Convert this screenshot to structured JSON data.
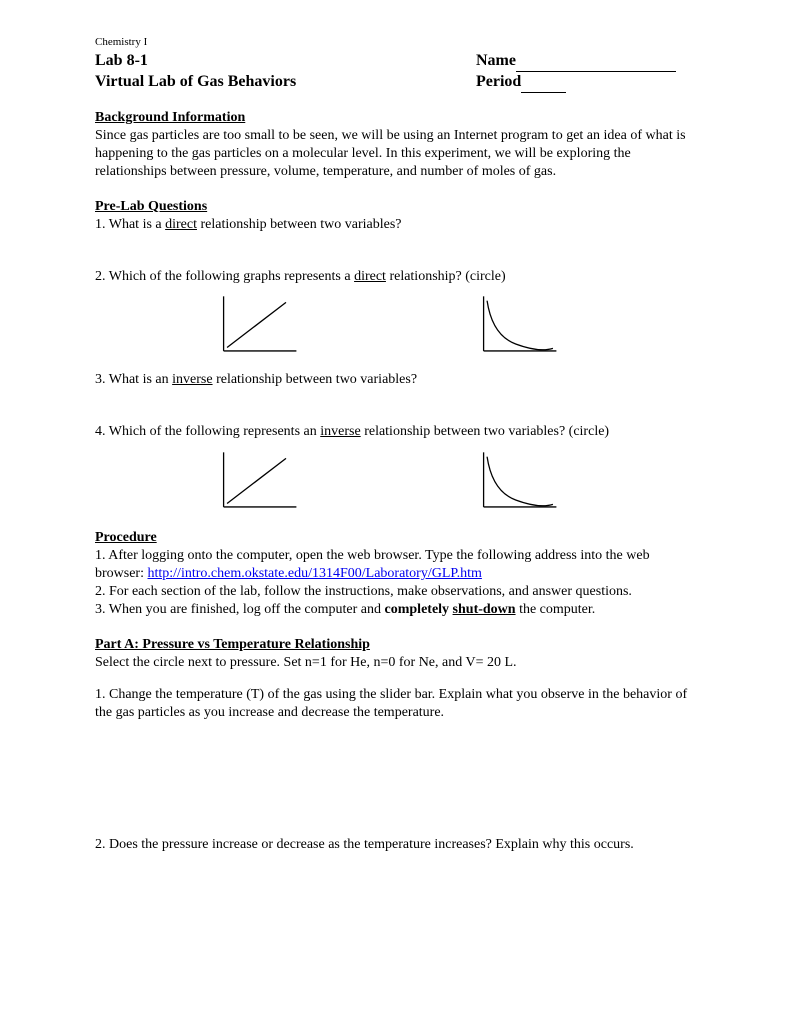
{
  "course": "Chemistry I",
  "lab_number": "Lab 8-1",
  "lab_title": "Virtual Lab of Gas Behaviors",
  "name_label": "Name",
  "period_label": "Period",
  "background": {
    "heading": "Background Information",
    "text": "Since gas particles are too small to be seen, we will be using an Internet program to get an idea of what is happening to the gas particles on a molecular level. In this experiment, we will be exploring the relationships between pressure, volume, temperature, and number of moles of gas."
  },
  "prelab": {
    "heading": "Pre-Lab Questions",
    "q1_prefix": "1. What is a ",
    "q1_u": "direct",
    "q1_suffix": " relationship between two variables?",
    "q2_prefix": "2. Which of the following graphs represents a ",
    "q2_u": "direct",
    "q2_suffix": " relationship? (circle)",
    "q3_prefix": "3. What is an ",
    "q3_u": "inverse",
    "q3_suffix": " relationship between two variables?",
    "q4_prefix": "4. Which of the following represents an ",
    "q4_u": "inverse",
    "q4_suffix": " relationship between two variables? (circle)"
  },
  "procedure": {
    "heading": "Procedure",
    "step1_prefix": "1. After logging onto the computer, open the web browser. Type the following address into the web browser: ",
    "step1_link": "http://intro.chem.okstate.edu/1314F00/Laboratory/GLP.htm",
    "step2": "2. For each section of the lab, follow the instructions, make observations, and answer questions.",
    "step3_prefix": "3. When you are finished, log off the computer and ",
    "step3_bold": "completely ",
    "step3_bold_u": "shut-down",
    "step3_suffix": " the computer."
  },
  "partA": {
    "heading": "Part A: Pressure vs Temperature Relationship",
    "intro": "Select the circle next to pressure. Set n=1 for He, n=0 for Ne, and V= 20 L.",
    "q1": "1. Change the temperature (T) of the gas using the slider bar. Explain what you observe in the behavior of the gas particles as you increase and decrease the temperature.",
    "q2": "2. Does the pressure increase or decrease as the temperature increases? Explain why this occurs."
  },
  "chart_data": [
    {
      "type": "line",
      "description": "direct relationship",
      "x": [
        0,
        10
      ],
      "y": [
        0,
        10
      ],
      "xlabel": "",
      "ylabel": "",
      "xlim": [
        0,
        10
      ],
      "ylim": [
        0,
        10
      ]
    },
    {
      "type": "line",
      "description": "inverse relationship",
      "x": [
        0.5,
        1,
        2,
        3,
        5,
        8,
        10
      ],
      "y": [
        10,
        7,
        4,
        2.5,
        1.5,
        0.9,
        0.6
      ],
      "xlabel": "",
      "ylabel": "",
      "xlim": [
        0,
        10
      ],
      "ylim": [
        0,
        10
      ]
    },
    {
      "type": "line",
      "description": "direct relationship",
      "x": [
        0,
        10
      ],
      "y": [
        0,
        10
      ],
      "xlabel": "",
      "ylabel": "",
      "xlim": [
        0,
        10
      ],
      "ylim": [
        0,
        10
      ]
    },
    {
      "type": "line",
      "description": "inverse relationship",
      "x": [
        0.5,
        1,
        2,
        3,
        5,
        8,
        10
      ],
      "y": [
        10,
        7,
        4,
        2.5,
        1.5,
        0.9,
        0.6
      ],
      "xlabel": "",
      "ylabel": "",
      "xlim": [
        0,
        10
      ],
      "ylim": [
        0,
        10
      ]
    }
  ]
}
